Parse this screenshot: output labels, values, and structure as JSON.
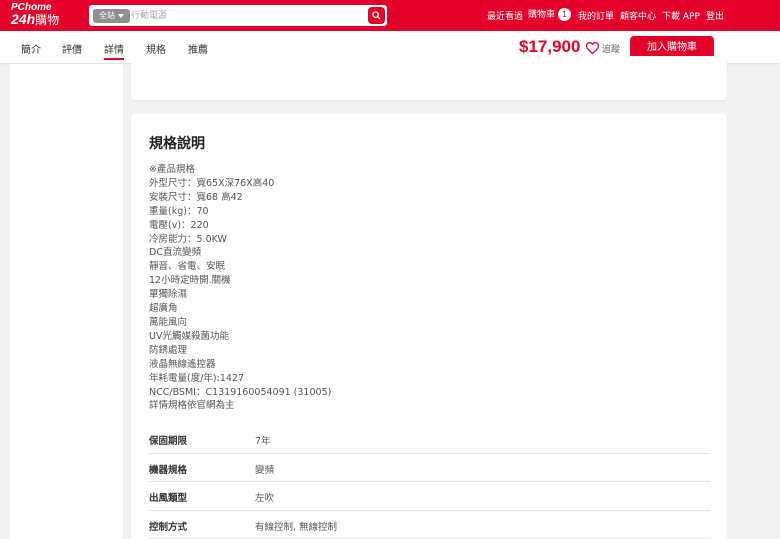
{
  "header": {
    "logo_top": "PChome",
    "logo_brand": "24h",
    "logo_cn": "購物",
    "search_scope": "全站",
    "search_placeholder": "行動電源",
    "nav": {
      "recent": "最近看過",
      "cart": "購物車",
      "cart_count": "1",
      "orders": "我的訂單",
      "support": "顧客中心",
      "app": "下載 APP",
      "logout": "登出"
    }
  },
  "subnav": {
    "tabs": [
      "簡介",
      "評價",
      "詳情",
      "規格",
      "推薦"
    ],
    "active_tab": "詳情",
    "price": "$17,900",
    "track_label": "追蹤",
    "add_to_cart": "加入購物車"
  },
  "spec_section": {
    "title": "規格說明",
    "lines": [
      "※產品規格",
      "外型尺寸：寬65X深76X高40",
      "安裝尺寸：寬68 高42",
      "重量(kg)：70",
      "電壓(v)：220",
      "冷房能力：5.0KW",
      "DC直流變頻",
      "靜音、省電、安眠",
      "12小時定時開.關機",
      "單獨除濕",
      "超廣角",
      "萬能風向",
      "UV光觸媒殺菌功能",
      "防銹處理",
      "液晶無線遙控器",
      "年耗電量(度/年):1427",
      "NCC/BSMI：C1319160054091 (31005)",
      "詳情規格依官網為主"
    ],
    "table": [
      {
        "key": "保固期限",
        "value": "7年"
      },
      {
        "key": "機器規格",
        "value": "變頻"
      },
      {
        "key": "出風類型",
        "value": "左吹"
      },
      {
        "key": "控制方式",
        "value": "有線控制, 無線控制"
      }
    ]
  },
  "colors": {
    "brand_red": "#e3022b",
    "page_bg": "#f2f2f2"
  }
}
